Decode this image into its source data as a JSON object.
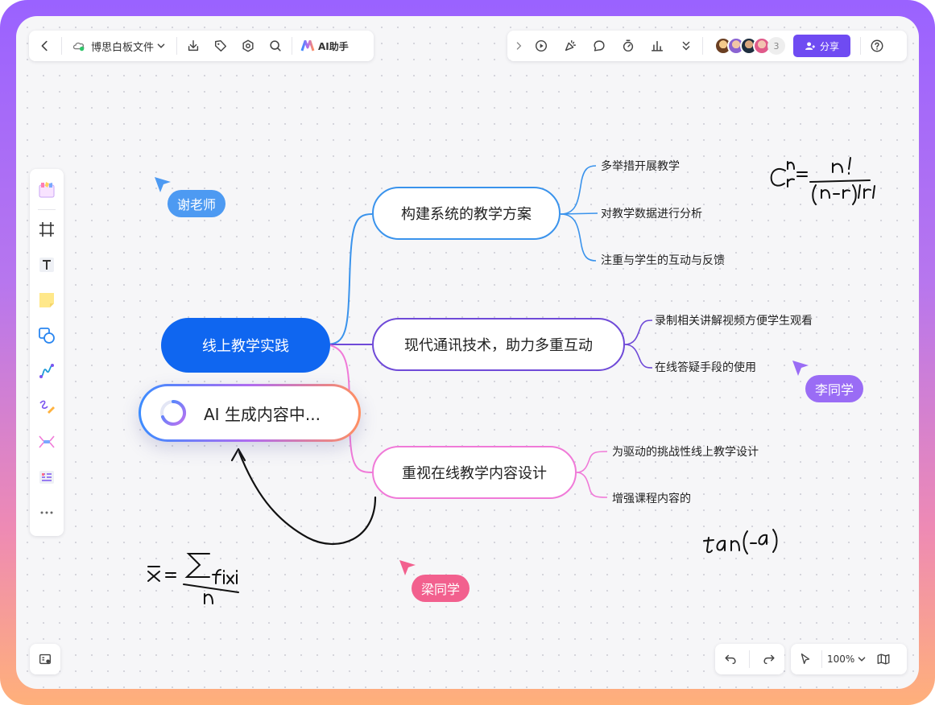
{
  "toolbar": {
    "file_title": "博思白板文件",
    "ai_label": "AI助手",
    "collaborator_count": "3",
    "share_label": "分享"
  },
  "mindmap": {
    "root": "线上教学实践",
    "ai_generating": "AI 生成内容中...",
    "branches": [
      {
        "label": "构建系统的教学方案",
        "children": [
          "多举措开展教学",
          "对教学数据进行分析",
          "注重与学生的互动与反馈"
        ]
      },
      {
        "label": "现代通讯技术，助力多重互动",
        "children": [
          "录制相关讲解视频方便学生观看",
          "在线答疑手段的使用"
        ]
      },
      {
        "label": "重视在线教学内容设计",
        "children": [
          "为驱动的挑战性线上教学设计",
          "增强课程内容的"
        ]
      }
    ]
  },
  "cursors": [
    {
      "name": "谢老师",
      "color": "#4d9af2"
    },
    {
      "name": "李同学",
      "color": "#9a6cf5"
    },
    {
      "name": "梁同学",
      "color": "#f2608e"
    }
  ],
  "bottom": {
    "zoom": "100%"
  },
  "colors": {
    "primary": "#0f66f0",
    "share": "#6f4bf2",
    "branch1": "#3a93ec",
    "branch2": "#6f4ad8",
    "branch3": "#f07ad8"
  }
}
